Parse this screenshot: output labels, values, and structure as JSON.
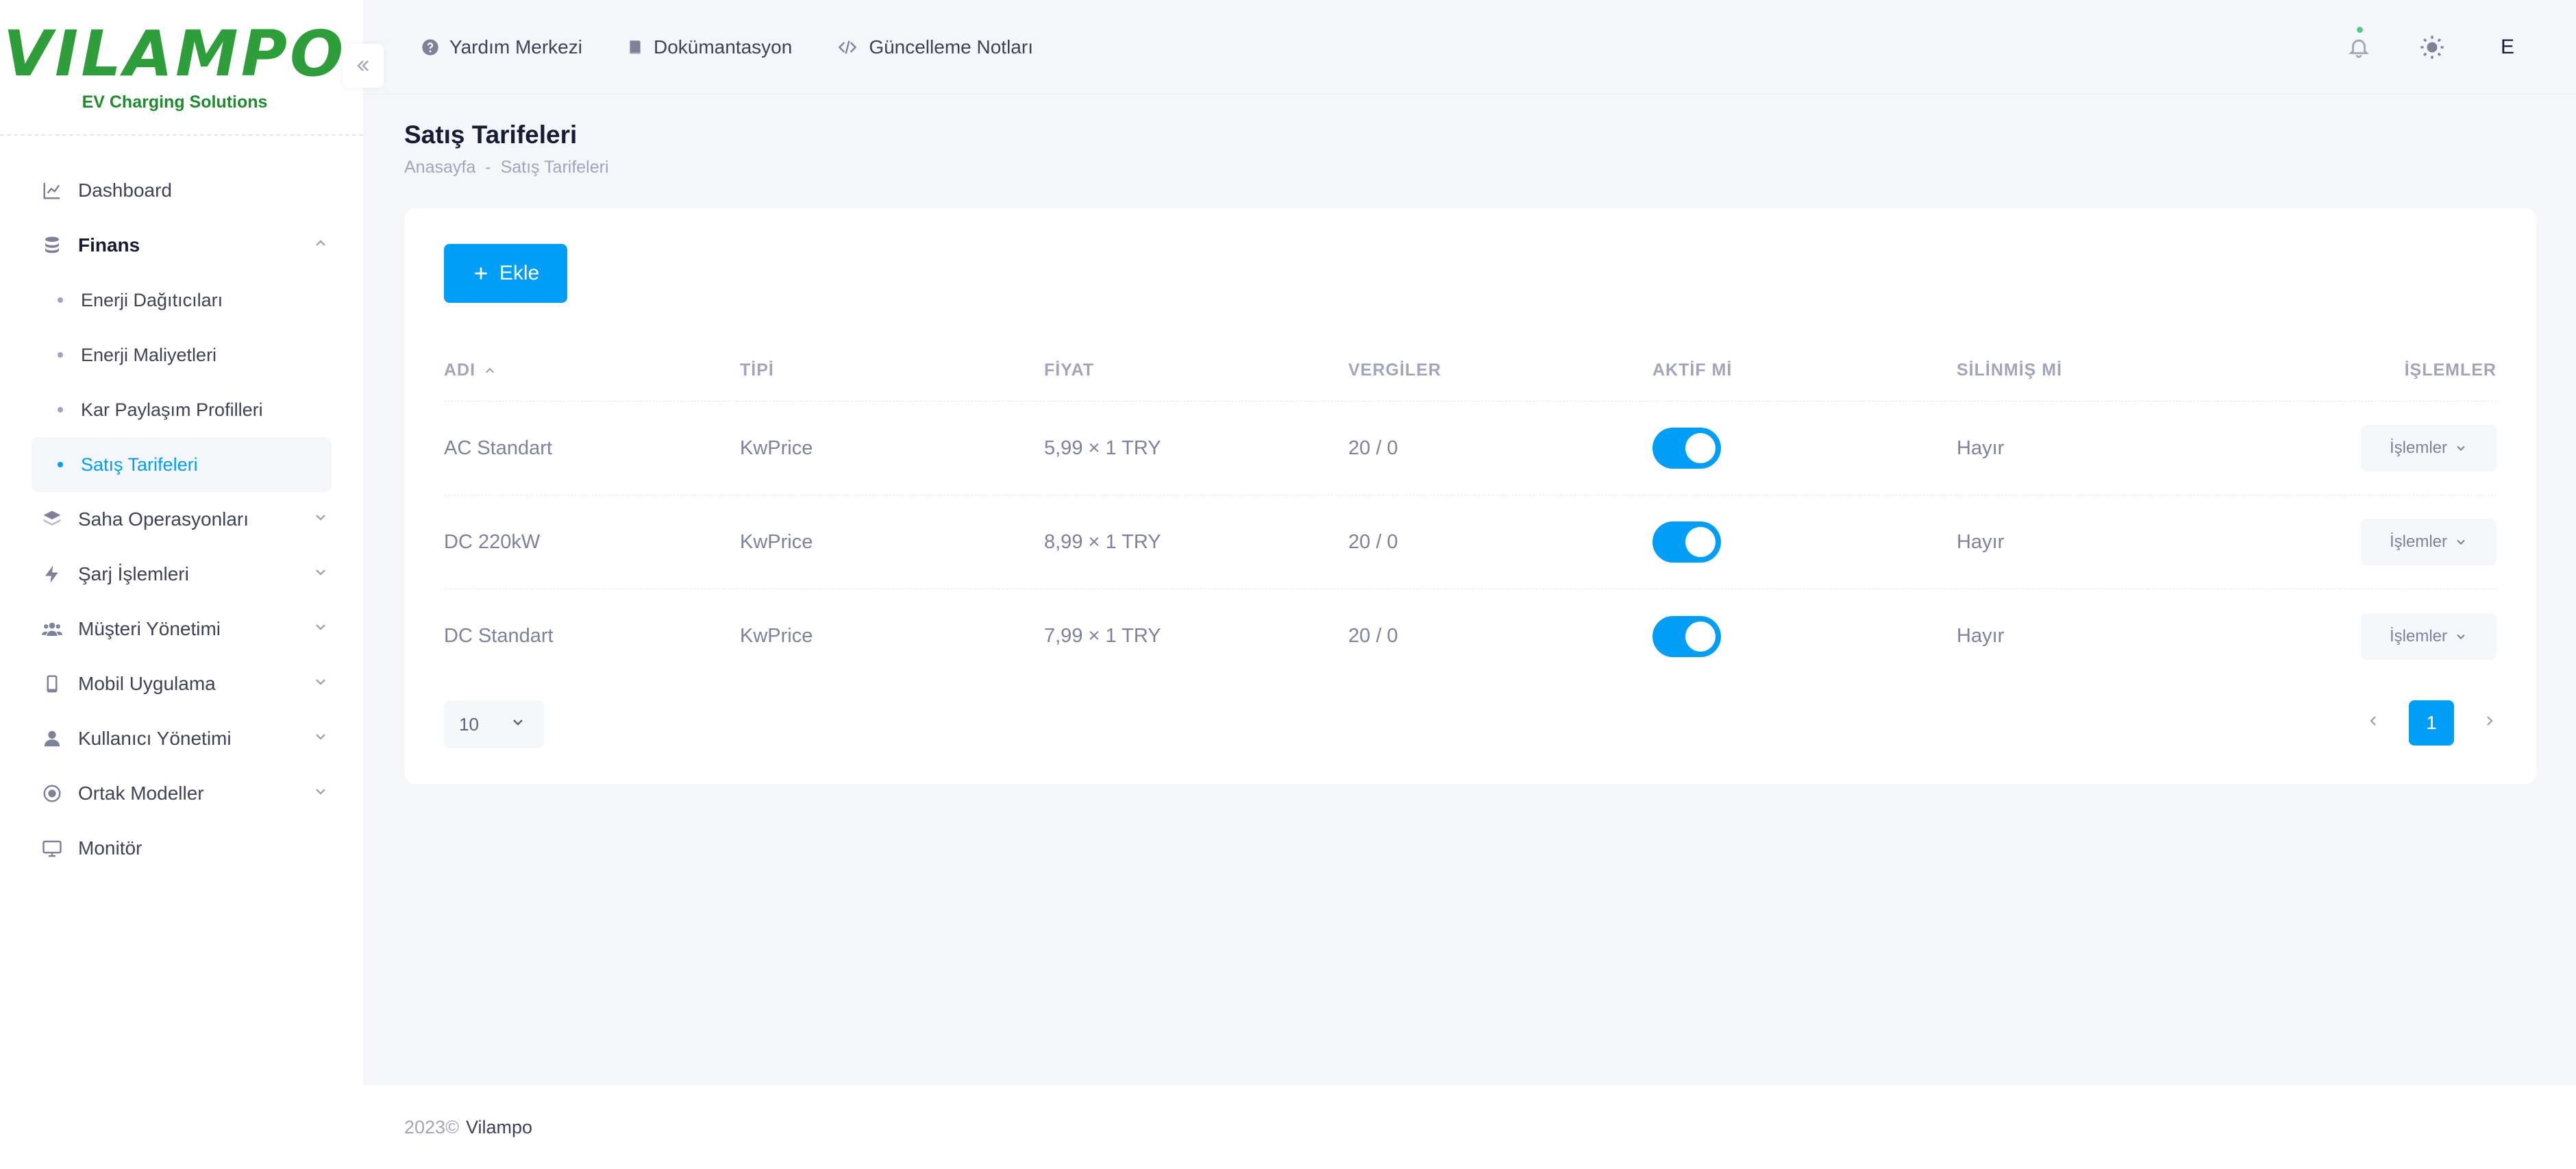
{
  "brand": {
    "logo_text": "VILAMPO",
    "logo_sub": "EV Charging Solutions",
    "color": "#2e9e3a"
  },
  "sidebar": {
    "items": [
      {
        "label": "Dashboard",
        "icon": "chart-line-icon"
      },
      {
        "label": "Finans",
        "icon": "coins-icon",
        "expanded": true,
        "children": [
          {
            "label": "Enerji Dağıtıcıları"
          },
          {
            "label": "Enerji Maliyetleri"
          },
          {
            "label": "Kar Paylaşım Profilleri"
          },
          {
            "label": "Satış Tarifeleri",
            "active": true
          }
        ]
      },
      {
        "label": "Saha Operasyonları",
        "icon": "layers-icon"
      },
      {
        "label": "Şarj İşlemleri",
        "icon": "bolt-icon"
      },
      {
        "label": "Müşteri Yönetimi",
        "icon": "users-icon"
      },
      {
        "label": "Mobil Uygulama",
        "icon": "phone-icon"
      },
      {
        "label": "Kullanıcı Yönetimi",
        "icon": "user-icon"
      },
      {
        "label": "Ortak Modeller",
        "icon": "circle-icon"
      },
      {
        "label": "Monitör",
        "icon": "monitor-icon"
      }
    ]
  },
  "header": {
    "links": [
      {
        "label": "Yardım Merkezi",
        "icon": "help-circle-icon"
      },
      {
        "label": "Dokümantasyon",
        "icon": "book-icon"
      },
      {
        "label": "Güncelleme Notları",
        "icon": "code-icon"
      }
    ],
    "user_initial": "E"
  },
  "page": {
    "title": "Satış Tarifeleri",
    "breadcrumb": [
      "Anasayfa",
      "-",
      "Satış Tarifeleri"
    ]
  },
  "toolbar": {
    "add_label": "Ekle"
  },
  "table": {
    "columns": [
      "ADI",
      "TİPİ",
      "FİYAT",
      "VERGİLER",
      "AKTİF Mİ",
      "SİLİNMİŞ Mİ",
      "İŞLEMLER"
    ],
    "rows": [
      {
        "name": "AC Standart",
        "type": "KwPrice",
        "price": "5,99 × 1 TRY",
        "taxes": "20 / 0",
        "active": true,
        "deleted": "Hayır",
        "action": "İşlemler"
      },
      {
        "name": "DC 220kW",
        "type": "KwPrice",
        "price": "8,99 × 1 TRY",
        "taxes": "20 / 0",
        "active": true,
        "deleted": "Hayır",
        "action": "İşlemler"
      },
      {
        "name": "DC Standart",
        "type": "KwPrice",
        "price": "7,99 × 1 TRY",
        "taxes": "20 / 0",
        "active": true,
        "deleted": "Hayır",
        "action": "İşlemler"
      }
    ]
  },
  "pagination": {
    "page_size": "10",
    "current_page": "1"
  },
  "footer": {
    "year": "2023©",
    "brand": "Vilampo"
  },
  "colors": {
    "primary": "#009ef7",
    "background": "#f4f6fa",
    "brand_green": "#2e9e3a"
  }
}
